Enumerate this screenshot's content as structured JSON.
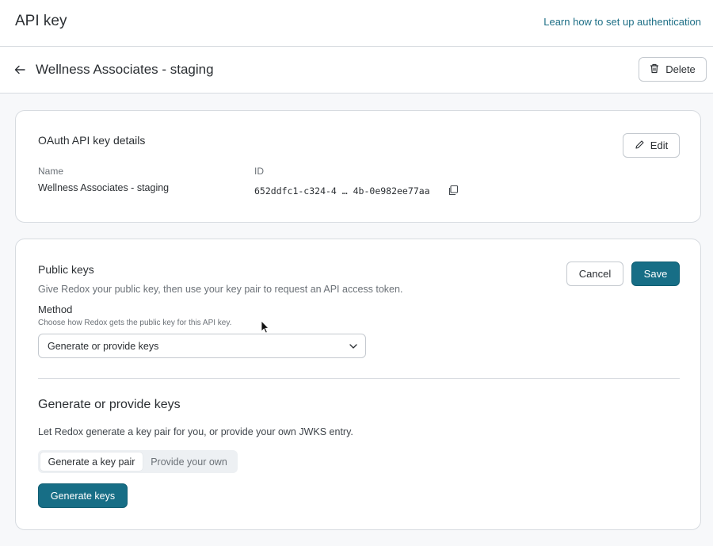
{
  "header": {
    "title": "API key",
    "help_link": "Learn how to set up authentication"
  },
  "record": {
    "title": "Wellness Associates - staging",
    "delete_label": "Delete"
  },
  "details_card": {
    "title": "OAuth API key details",
    "edit_label": "Edit",
    "name_label": "Name",
    "name_value": "Wellness Associates - staging",
    "id_label": "ID",
    "id_value": "652ddfc1-c324-4 … 4b-0e982ee77aa"
  },
  "keys_card": {
    "title": "Public keys",
    "description": "Give Redox your public key, then use your key pair to request an API access token.",
    "cancel_label": "Cancel",
    "save_label": "Save",
    "method_label": "Method",
    "method_hint": "Choose how Redox gets the public key for this API key.",
    "method_selected": "Generate or provide keys",
    "section_title": "Generate or provide keys",
    "section_description": "Let Redox generate a key pair for you, or provide your own JWKS entry.",
    "segments": [
      {
        "label": "Generate a key pair",
        "active": true
      },
      {
        "label": "Provide your own",
        "active": false
      }
    ],
    "generate_label": "Generate keys"
  },
  "icons": {
    "back": "arrow-left-icon",
    "delete": "trash-icon",
    "edit": "pencil-icon",
    "copy": "copy-icon",
    "dropdown": "chevron-down-icon"
  },
  "colors": {
    "primary": "#176e86",
    "link": "#1e6f86",
    "border": "#d7dbe0"
  }
}
